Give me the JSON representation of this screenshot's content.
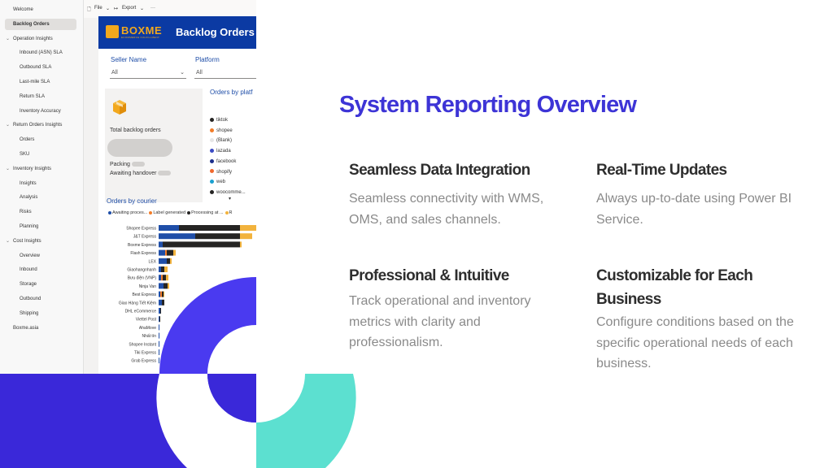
{
  "slide": {
    "title": "System Reporting Overview",
    "features": [
      {
        "title": "Seamless Data Integration",
        "desc": "Seamless connectivity with WMS, OMS, and sales channels."
      },
      {
        "title": "Real-Time Updates",
        "desc": "Always up-to-date using Power BI Service."
      },
      {
        "title": "Professional & Intuitive",
        "desc": "Track operational and inventory metrics with clarity and professionalism."
      },
      {
        "title": "Customizable for Each Business",
        "desc": "Configure conditions based on the specific operational needs of each business."
      }
    ],
    "colors": {
      "accent": "#3d34d6",
      "teal": "#5ce0d0",
      "indigo": "#3a28d9"
    }
  },
  "screenshot": {
    "sidebar": [
      {
        "label": "Welcome",
        "level": 0
      },
      {
        "label": "Backlog Orders",
        "level": 0,
        "active": true
      },
      {
        "label": "Operation Insights",
        "level": 0,
        "group": true
      },
      {
        "label": "Inbound (ASN) SLA",
        "level": 1
      },
      {
        "label": "Outbound SLA",
        "level": 1
      },
      {
        "label": "Last-mile SLA",
        "level": 1
      },
      {
        "label": "Return SLA",
        "level": 1
      },
      {
        "label": "Inventory Accuracy",
        "level": 1
      },
      {
        "label": "Return Orders Insights",
        "level": 0,
        "group": true
      },
      {
        "label": "Orders",
        "level": 1
      },
      {
        "label": "SKU",
        "level": 1
      },
      {
        "label": "Inventory Insights",
        "level": 0,
        "group": true
      },
      {
        "label": "Insights",
        "level": 1
      },
      {
        "label": "Analysis",
        "level": 1
      },
      {
        "label": "Risks",
        "level": 1
      },
      {
        "label": "Planning",
        "level": 1
      },
      {
        "label": "Cost Insights",
        "level": 0,
        "group": true
      },
      {
        "label": "Overview",
        "level": 1
      },
      {
        "label": "Inbound",
        "level": 1
      },
      {
        "label": "Storage",
        "level": 1
      },
      {
        "label": "Outbound",
        "level": 1
      },
      {
        "label": "Shipping",
        "level": 1
      },
      {
        "label": "Boxme.asia",
        "level": 0
      }
    ],
    "toolbar": {
      "file": "File",
      "export": "Export",
      "more": "···"
    },
    "banner": {
      "logo": "BOXME",
      "logo_sub": "ECOMMERCE FULFILLMENT",
      "title": "Backlog Orders"
    },
    "filters": {
      "seller": {
        "label": "Seller Name",
        "value": "All"
      },
      "platform": {
        "label": "Platform",
        "value": "All"
      }
    },
    "card": {
      "label": "Total backlog orders",
      "packing": "Packing",
      "handover": "Awaiting handover"
    },
    "platforms": {
      "title": "Orders by platf",
      "items": [
        {
          "name": "tiktok",
          "color": "#252423"
        },
        {
          "name": "shopee",
          "color": "#f27c28"
        },
        {
          "name": "(Blank)",
          "color": "#e6e6e6"
        },
        {
          "name": "lazada",
          "color": "#3b4bc4"
        },
        {
          "name": "facebook",
          "color": "#1b2f8c"
        },
        {
          "name": "shopify",
          "color": "#f0682d"
        },
        {
          "name": "web",
          "color": "#1aa0d0"
        },
        {
          "name": "woocomme...",
          "color": "#252423"
        }
      ],
      "more": "▾"
    },
    "courier": {
      "title": "Orders by courier",
      "legend": [
        {
          "name": "Awaiting proces...",
          "color": "#1f4ea8"
        },
        {
          "name": "Label generated",
          "color": "#f27c28"
        },
        {
          "name": "Processing at ...",
          "color": "#252423"
        },
        {
          "name": "R",
          "color": "#f2b33d"
        }
      ]
    }
  },
  "chart_data": {
    "type": "bar",
    "orientation": "horizontal",
    "stacked": true,
    "title": "Orders by courier",
    "categories": [
      "Shopee Express",
      "J&T Express",
      "Boxme Express",
      "Flash Express",
      "LEX",
      "Giaohangnhanh",
      "Bưu điện (VNP)",
      "Ninja Van",
      "Best Express",
      "Giao Hàng Tiết Kiệm",
      "DHL eCommerce",
      "Viettel Post",
      "AhaMove",
      "Nhất tín",
      "Shopee Instant",
      "Tiki Express",
      "Grab Express"
    ],
    "series": [
      {
        "name": "Awaiting proces...",
        "color": "#1f4ea8",
        "values": [
          25,
          45,
          5,
          8,
          10,
          3,
          3,
          6,
          2,
          4,
          2,
          1,
          1,
          1,
          1,
          1,
          1
        ]
      },
      {
        "name": "Label generated",
        "color": "#f27c28",
        "values": [
          0,
          0,
          0,
          2,
          0,
          0,
          2,
          0,
          2,
          0,
          0,
          0,
          0,
          0,
          0,
          0,
          0
        ]
      },
      {
        "name": "Processing at ...",
        "color": "#252423",
        "values": [
          75,
          55,
          95,
          8,
          4,
          4,
          4,
          5,
          2,
          3,
          1,
          1,
          0,
          0,
          0,
          0,
          0
        ]
      },
      {
        "name": "R",
        "color": "#f2b33d",
        "values": [
          20,
          15,
          2,
          3,
          2,
          4,
          3,
          2,
          1,
          0,
          0,
          0,
          0,
          0,
          0,
          0,
          0
        ]
      }
    ]
  }
}
